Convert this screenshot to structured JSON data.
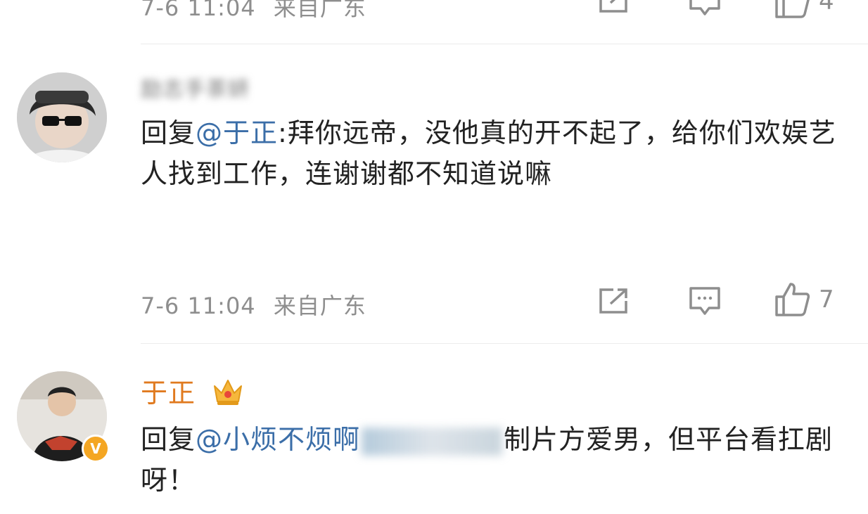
{
  "top_comment": {
    "time": "7-6 11:04",
    "location": "来自广东",
    "like_count": "4"
  },
  "comment1": {
    "username": "励志手茶妍",
    "reply_prefix": "回复",
    "mention": "@于正",
    "text": ":拜你远帝，没他真的开不起了，给你们欢娱艺人找到工作，连谢谢都不知道说嘛",
    "time": "7-6 11:04",
    "location": "来自广东",
    "like_count": "7"
  },
  "comment2": {
    "username": "于正",
    "reply_prefix": "回复",
    "mention": "@小烦不烦啊",
    "text": "制片方爱男，但平台看扛剧呀！",
    "verified_badge": "V"
  },
  "colors": {
    "mention": "#3b6ea8",
    "vip_name": "#e07a1f",
    "meta_gray": "#8e8e8e"
  },
  "icons": {
    "share": "share-icon",
    "comment": "comment-icon",
    "like": "like-icon",
    "crown": "crown-badge-icon"
  }
}
